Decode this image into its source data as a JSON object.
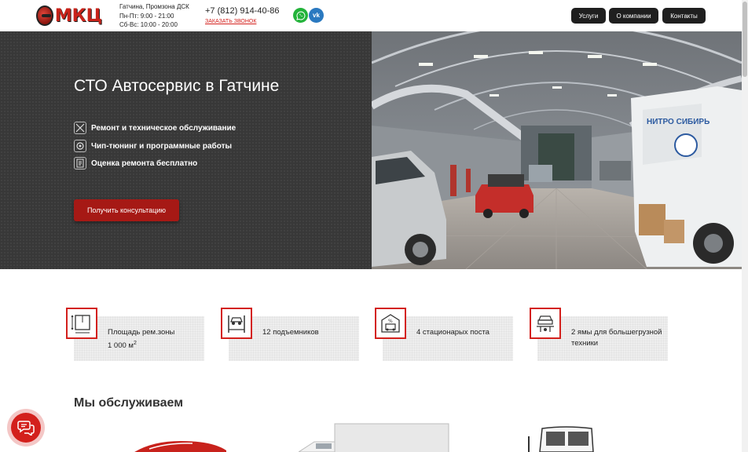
{
  "header": {
    "logo_text": "МКЦ",
    "address_line1": "Гатчина, Промзона ДСК",
    "hours_weekdays": "Пн-Пт: 9:00 - 21:00",
    "hours_weekend": "Сб-Вс: 10:00 - 20:00",
    "phone": "+7 (812) 914-40-86",
    "callback_link": "ЗАКАЗАТЬ ЗВОНОК",
    "social": [
      {
        "name": "whatsapp-icon",
        "color": "#23b33a"
      },
      {
        "name": "vk-icon",
        "color": "#2a79c0",
        "label": "vk"
      }
    ],
    "nav": [
      "Услуги",
      "О компании",
      "Контакты"
    ]
  },
  "hero": {
    "title": "СТО Автосервис в Гатчине",
    "features": [
      {
        "icon": "tools-icon",
        "label": "Ремонт и техническое обслуживание"
      },
      {
        "icon": "chip-icon",
        "label": "Чип-тюнинг и программные работы"
      },
      {
        "icon": "estimate-icon",
        "label": "Оценка ремонта бесплатно"
      }
    ],
    "cta_label": "Получить консультацию",
    "photo_van_text": "НИТРО СИБИРЬ"
  },
  "stats": [
    {
      "icon": "area-plan-icon",
      "label": "Площадь рем.зоны",
      "value": "1 000 м",
      "sup": "2"
    },
    {
      "icon": "car-lift-icon",
      "label": "12 подъемников"
    },
    {
      "icon": "service-post-icon",
      "label": "4 стационарых поста"
    },
    {
      "icon": "inspection-pit-icon",
      "label": "2 ямы для большегрузной техники"
    }
  ],
  "services_section": {
    "title": "Мы обслуживаем"
  },
  "colors": {
    "accent": "#d3201c",
    "dark": "#1f1f1f",
    "hero_bg": "#383838"
  }
}
